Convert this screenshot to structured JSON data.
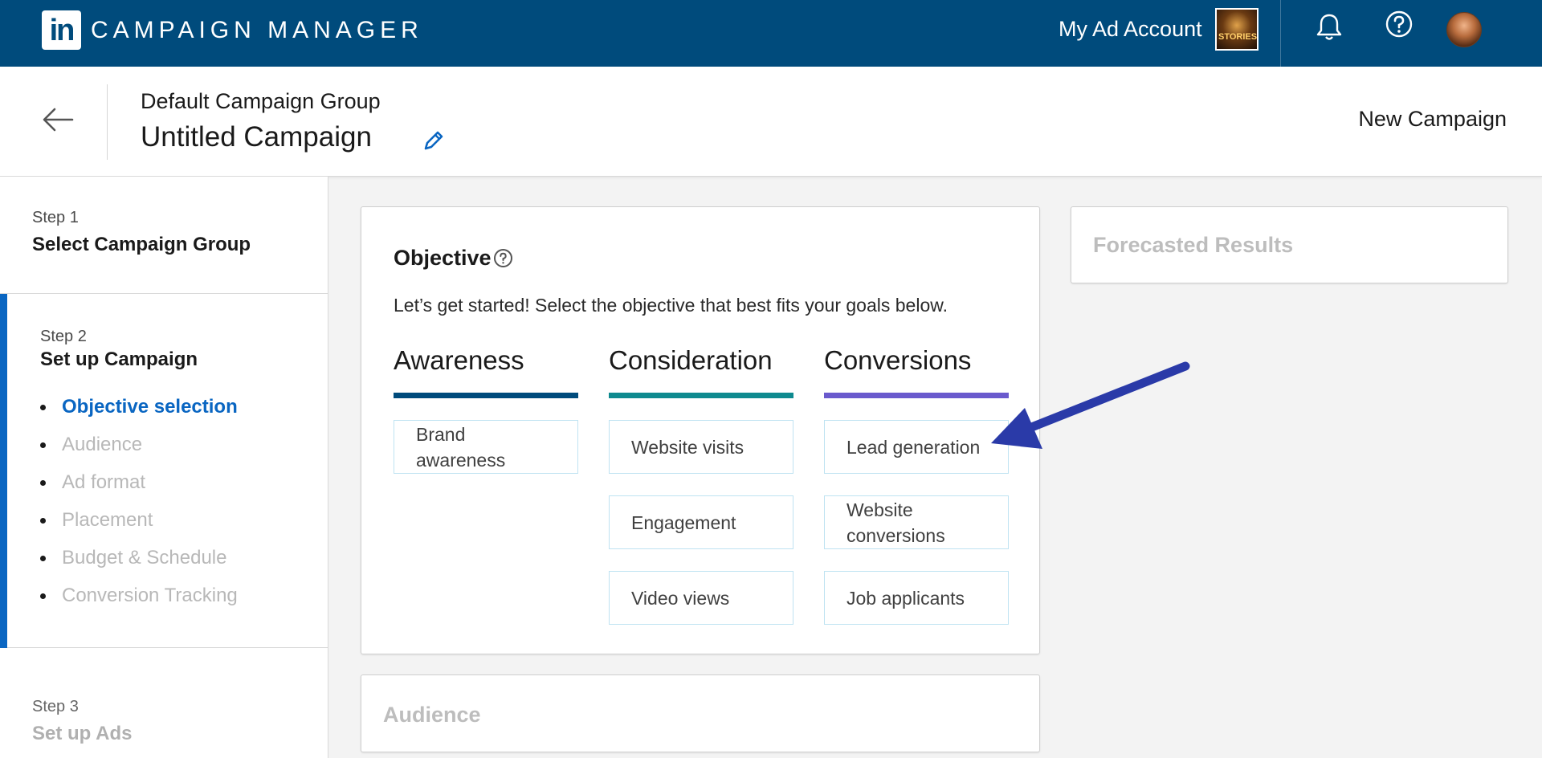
{
  "topbar": {
    "brand": "CAMPAIGN MANAGER",
    "logo_text": "in",
    "account_name": "My Ad Account",
    "account_thumb_text": "STORIES",
    "icons": [
      "bell-icon",
      "help-icon",
      "avatar"
    ]
  },
  "header": {
    "group_name": "Default Campaign Group",
    "campaign_name": "Untitled Campaign",
    "new_campaign_label": "New Campaign",
    "icons": [
      "back-arrow-icon",
      "pencil-icon"
    ]
  },
  "sidebar": {
    "step1": {
      "label": "Step 1",
      "title": "Select Campaign Group"
    },
    "step2": {
      "label": "Step 2",
      "title": "Set up Campaign",
      "substeps": [
        "Objective selection",
        "Audience",
        "Ad format",
        "Placement",
        "Budget & Schedule",
        "Conversion Tracking"
      ],
      "active_substep": "Objective selection"
    },
    "step3": {
      "label": "Step 3",
      "title": "Set up Ads"
    }
  },
  "objective": {
    "title": "Objective",
    "description": "Let’s get started! Select the objective that best fits your goals below.",
    "columns": [
      {
        "title": "Awareness",
        "color": "#004b7c",
        "options": [
          "Brand awareness"
        ]
      },
      {
        "title": "Consideration",
        "color": "#0e8a8f",
        "options": [
          "Website visits",
          "Engagement",
          "Video views"
        ]
      },
      {
        "title": "Conversions",
        "color": "#6a5acd",
        "options": [
          "Lead generation",
          "Website conversions",
          "Job applicants"
        ]
      }
    ]
  },
  "audience_card": {
    "title": "Audience"
  },
  "forecast_card": {
    "title": "Forecasted Results"
  },
  "colors": {
    "topbar": "#004b7c",
    "accent": "#0a66c2",
    "annotation_arrow": "#2a3aa8"
  }
}
